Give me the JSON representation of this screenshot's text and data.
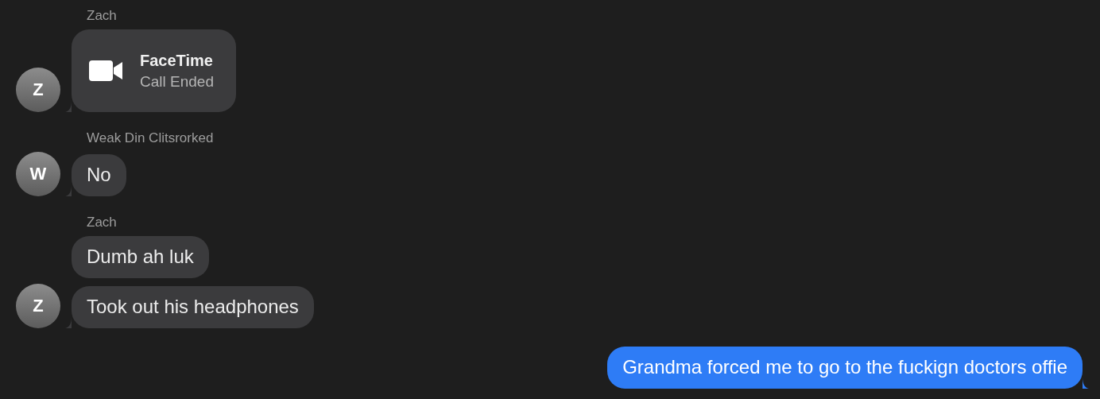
{
  "groups": [
    {
      "sender": "Zach",
      "avatar": "Z",
      "messages": [
        {
          "kind": "facetime",
          "title": "FaceTime",
          "subtitle": "Call Ended"
        }
      ]
    },
    {
      "sender": "Weak Din Clitsrorked",
      "avatar": "W",
      "messages": [
        {
          "kind": "text",
          "text": "No"
        }
      ]
    },
    {
      "sender": "Zach",
      "avatar": "Z",
      "messages": [
        {
          "kind": "text",
          "text": "Dumb ah luk"
        },
        {
          "kind": "text",
          "text": "Took out his headphones"
        }
      ]
    }
  ],
  "outgoing": [
    {
      "kind": "text",
      "text": "Grandma forced me to go to the fuckign doctors offie"
    }
  ]
}
